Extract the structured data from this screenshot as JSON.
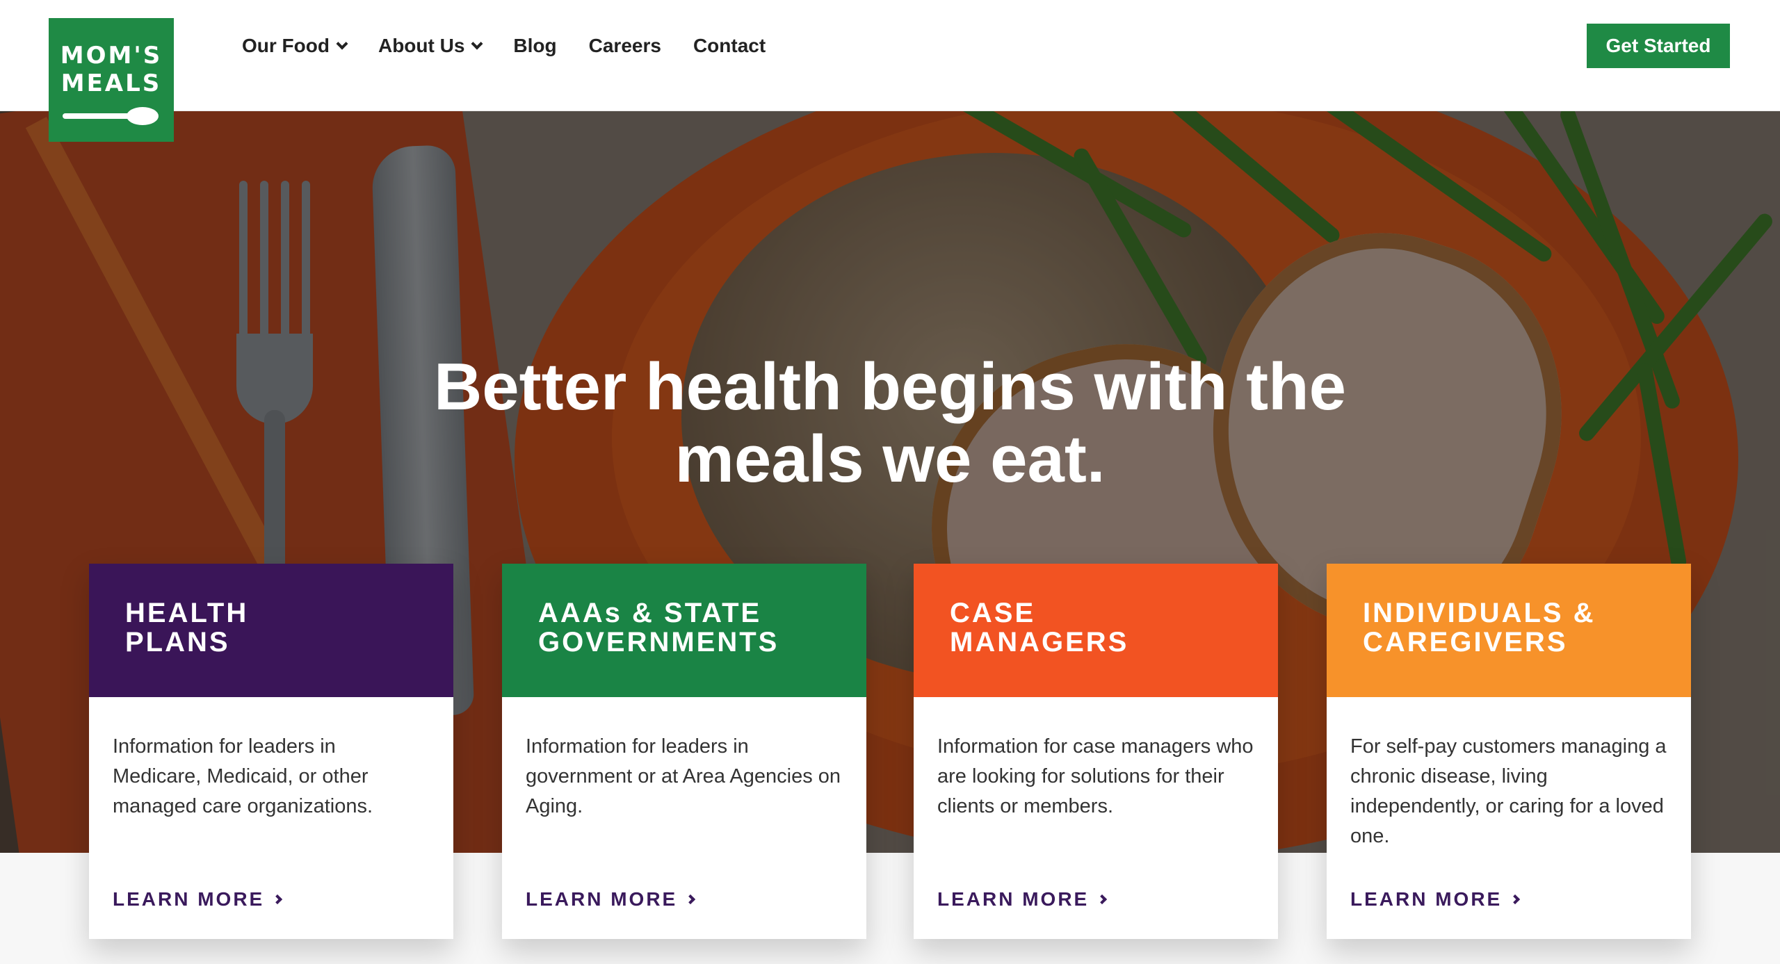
{
  "logo": {
    "line1": "MOM'S",
    "line2": "MEALS"
  },
  "nav": {
    "items": [
      {
        "label": "Our Food",
        "dropdown": true
      },
      {
        "label": "About Us",
        "dropdown": true
      },
      {
        "label": "Blog",
        "dropdown": false
      },
      {
        "label": "Careers",
        "dropdown": false
      },
      {
        "label": "Contact",
        "dropdown": false
      }
    ]
  },
  "cta": {
    "label": "Get Started"
  },
  "hero": {
    "line1": "Better health begins with the",
    "line2": "meals we eat."
  },
  "cards": [
    {
      "title_line1": "HEALTH",
      "title_line2": "PLANS",
      "color": "#3a1558",
      "body": "Information for leaders in Medicare, Medicaid, or other managed care organizations.",
      "link": "LEARN MORE"
    },
    {
      "title_line1": "AAAs & STATE",
      "title_line2": "GOVERNMENTS",
      "color": "#1a8445",
      "body": "Information for leaders in government or at Area Agencies on Aging.",
      "link": "LEARN MORE"
    },
    {
      "title_line1": "CASE",
      "title_line2": "MANAGERS",
      "color": "#f25322",
      "body": "Information for case managers who are looking for solutions for their clients or members.",
      "link": "LEARN MORE"
    },
    {
      "title_line1": "INDIVIDUALS &",
      "title_line2": "CAREGIVERS",
      "color": "#f7922a",
      "body": "For self-pay customers managing a chronic disease, living independently, or caring for a loved one.",
      "link": "LEARN MORE"
    }
  ],
  "colors": {
    "brand_green": "#1f8a45",
    "link_purple": "#3a1a5c"
  }
}
